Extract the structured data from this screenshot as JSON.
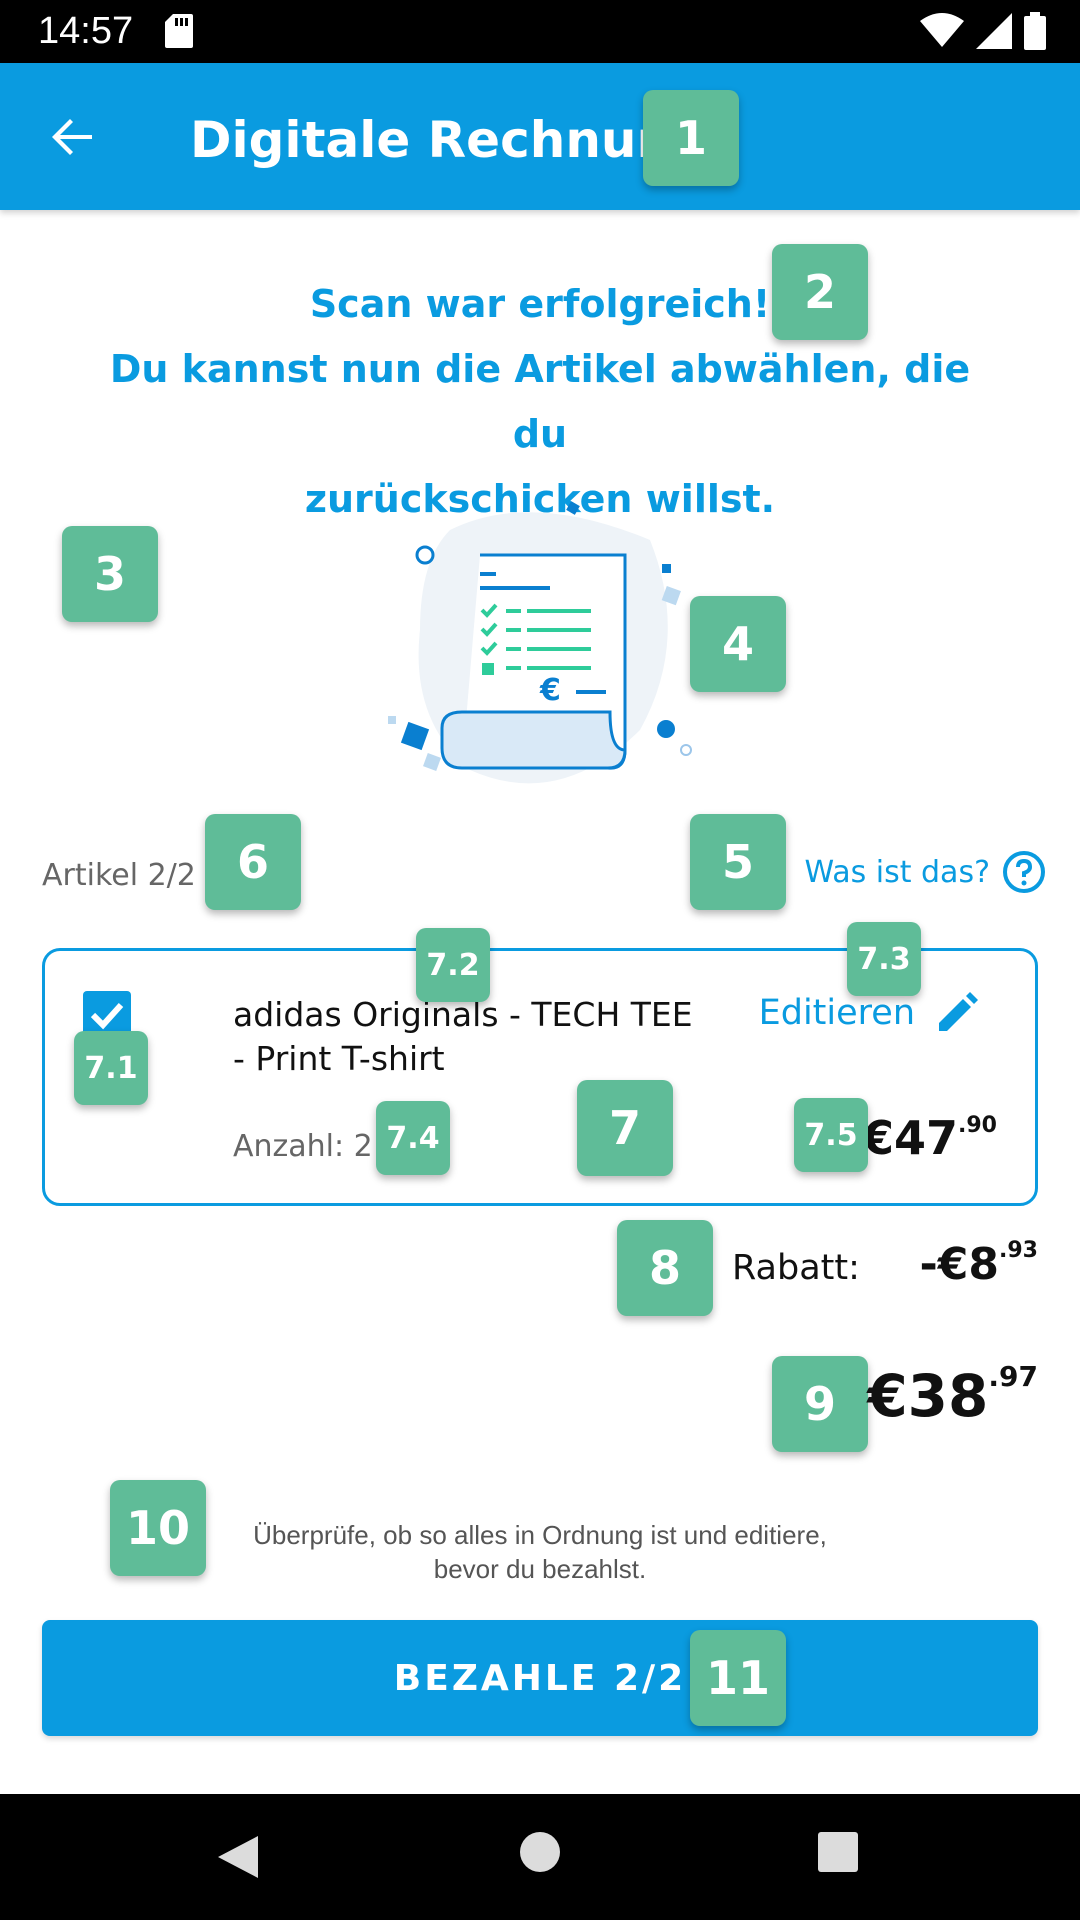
{
  "status_bar": {
    "time": "14:57"
  },
  "app_bar": {
    "title": "Digitale Rechnung"
  },
  "headline": {
    "line1": "Scan war erfolgreich!",
    "line2": "Du kannst nun die Artikel abwählen, die du",
    "line3": "zurückschicken willst."
  },
  "items_header": {
    "count_label": "Artikel 2/2",
    "help_label": "Was ist das?"
  },
  "item": {
    "checked": true,
    "name_line1": "adidas Originals - TECH TEE",
    "name_line2": "- Print T-shirt",
    "edit_label": "Editieren",
    "quantity_label": "Anzahl: 2",
    "price_main": "€47",
    "price_cents": ".90"
  },
  "discount": {
    "label": "Rabatt:",
    "value_main": "-€8",
    "value_cents": ".93"
  },
  "total": {
    "value_main": "€38",
    "value_cents": ".97"
  },
  "note": {
    "line1": "Überprüfe, ob so alles in Ordnung ist und editiere,",
    "line2": "bevor du bezahlst."
  },
  "pay_button": {
    "label": "BEZAHLE 2/2"
  },
  "annotation_badges": {
    "b1": "1",
    "b2": "2",
    "b3": "3",
    "b4": "4",
    "b5": "5",
    "b6": "6",
    "b7": "7",
    "b7_1": "7.1",
    "b7_2": "7.2",
    "b7_3": "7.3",
    "b7_4": "7.4",
    "b7_5": "7.5",
    "b8": "8",
    "b9": "9",
    "b10": "10",
    "b11": "11"
  },
  "colors": {
    "accent": "#0a9be0",
    "badge": "#5fbc98",
    "status_bar": "#000000"
  },
  "icons": [
    "sd-card-icon",
    "wifi-icon",
    "signal-icon",
    "battery-icon",
    "back-arrow-icon",
    "receipt-illustration",
    "help-circle-icon",
    "checkbox-checked-icon",
    "pencil-icon",
    "nav-back-icon",
    "nav-home-icon",
    "nav-recents-icon"
  ]
}
